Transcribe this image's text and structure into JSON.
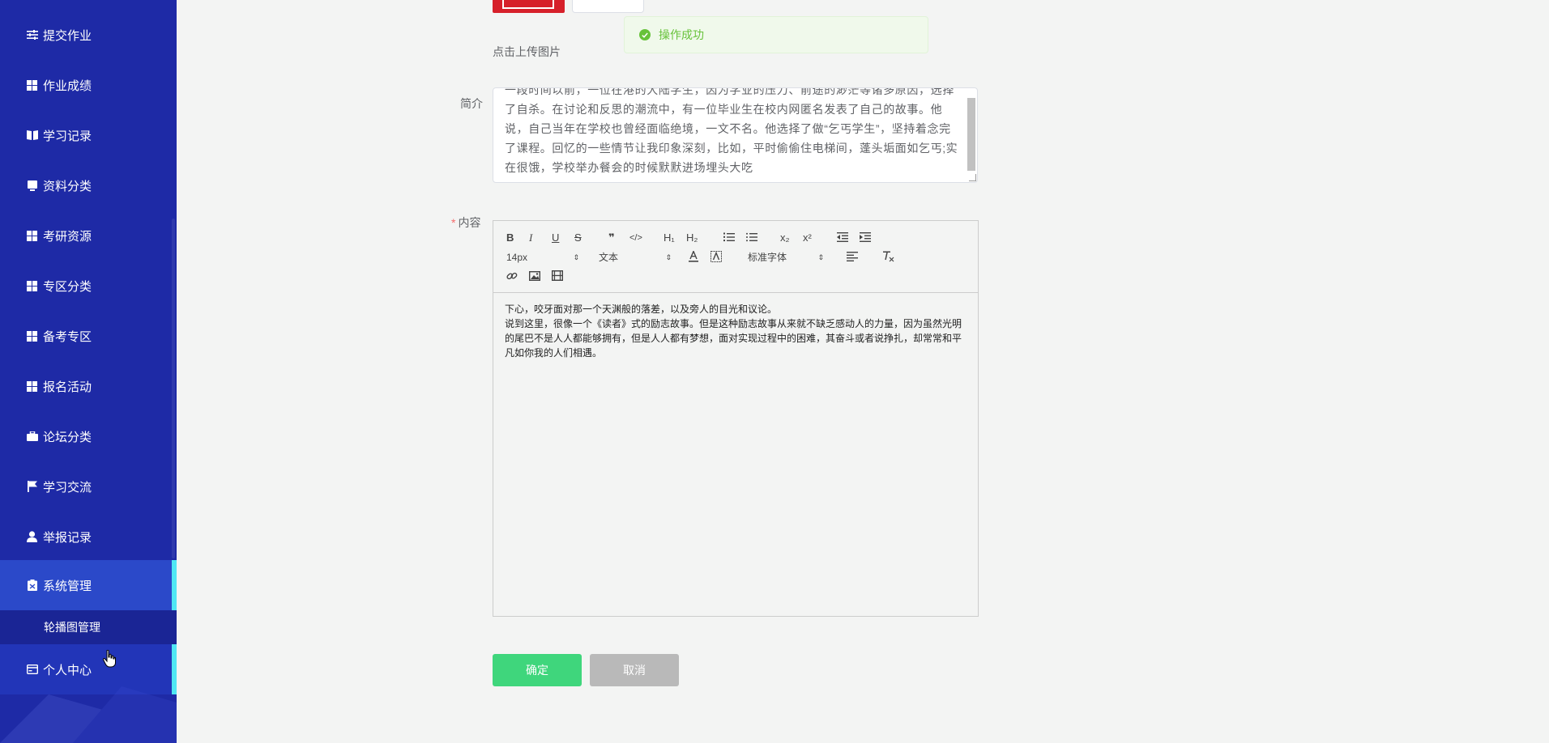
{
  "sidebar": {
    "items": [
      {
        "label": "提交作业",
        "icon": "sliders-icon"
      },
      {
        "label": "作业成绩",
        "icon": "grid-icon"
      },
      {
        "label": "学习记录",
        "icon": "book-icon"
      },
      {
        "label": "资料分类",
        "icon": "tablet-icon"
      },
      {
        "label": "考研资源",
        "icon": "grid-icon"
      },
      {
        "label": "专区分类",
        "icon": "grid-icon"
      },
      {
        "label": "备考专区",
        "icon": "grid-icon"
      },
      {
        "label": "报名活动",
        "icon": "grid-icon"
      },
      {
        "label": "论坛分类",
        "icon": "briefcase-icon"
      },
      {
        "label": "学习交流",
        "icon": "flag-icon"
      },
      {
        "label": "举报记录",
        "icon": "user-icon"
      },
      {
        "label": "系统管理",
        "icon": "clipboard-icon"
      }
    ],
    "submenu": {
      "label": "轮播图管理"
    },
    "personal": {
      "label": "个人中心",
      "icon": "card-icon"
    }
  },
  "upload": {
    "hint": "点击上传图片"
  },
  "toast": {
    "message": "操作成功"
  },
  "form": {
    "intro_label": "简介",
    "intro_text": "一段时间以前，一位在港的大陆学生，因为学业的压力、前途的渺茫等诸多原因，选择了自杀。在讨论和反思的潮流中，有一位毕业生在校内网匿名发表了自己的故事。他说，自己当年在学校也曾经面临绝境，一文不名。他选择了做“乞丐学生”，坚持着念完了课程。回忆的一些情节让我印象深刻，比如，平时偷偷住电梯间，蓬头垢面如乞丐;实在很饿，学校举办餐会的时候默默进场埋头大吃",
    "content_required_mark": "*",
    "content_label": "内容"
  },
  "editor": {
    "toolbar": {
      "bold": "B",
      "italic": "I",
      "underline": "U",
      "strike": "S",
      "blockquote": "❞",
      "code": "</>",
      "h1": "H₁",
      "h2": "H₂",
      "subscript": "x₂",
      "superscript": "x²",
      "size_value": "14px",
      "header_value": "文本",
      "font_value": "标准字体",
      "caret": "⇕"
    },
    "content": [
      "下心，咬牙面对那一个天渊般的落差，以及旁人的目光和议论。",
      "说到这里，很像一个《读者》式的励志故事。但是这种励志故事从来就不缺乏感动人的力量，因为虽然光明的尾巴不是人人都能够拥有，但是人人都有梦想，面对实现过程中的困难，其奋斗或者说挣扎，却常常和平凡如你我的人们相遇。"
    ]
  },
  "actions": {
    "confirm": "确定",
    "cancel": "取消"
  },
  "colors": {
    "sidebar_bg": "#1e2aa6",
    "sidebar_active": "#2b49c9",
    "active_indicator": "#4fe7f4",
    "confirm_btn": "#3fd67c",
    "cancel_btn": "#b9b9b9",
    "toast_text": "#67c23a"
  }
}
